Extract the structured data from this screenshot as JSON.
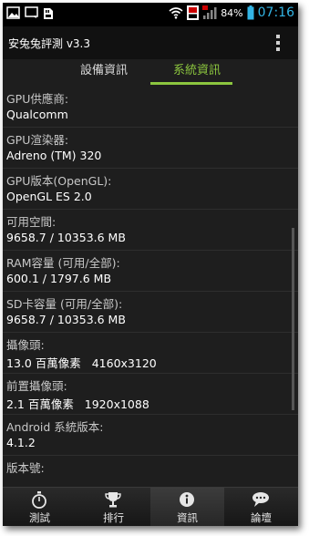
{
  "status_bar": {
    "battery_percent": "84%",
    "time": "07:16"
  },
  "app": {
    "title": "安兔兔評測 v3.3"
  },
  "tabs": [
    {
      "label": "設備資訊",
      "active": false
    },
    {
      "label": "系統資訊",
      "active": true
    }
  ],
  "items": [
    {
      "label": "GPU供應商:",
      "value": "Qualcomm"
    },
    {
      "label": "GPU渲染器:",
      "value": "Adreno (TM) 320"
    },
    {
      "label": "GPU版本(OpenGL):",
      "value": "OpenGL ES 2.0"
    },
    {
      "label": "可用空間:",
      "value": "9658.7 / 10353.6 MB"
    },
    {
      "label": "RAM容量 (可用/全部):",
      "value": "600.1 / 1797.6 MB"
    },
    {
      "label": "SD卡容量 (可用/全部):",
      "value": "9658.7 / 10353.6 MB"
    },
    {
      "label": "攝像頭:",
      "value": "13.0 百萬像素   4160x3120"
    },
    {
      "label": "前置攝像頭:",
      "value": "2.1 百萬像素   1920x1088"
    },
    {
      "label": "Android 系統版本:",
      "value": "4.1.2"
    },
    {
      "label": "版本號:",
      "value": ""
    }
  ],
  "bottom_nav": [
    {
      "label": "測試",
      "icon": "stopwatch-icon",
      "active": false
    },
    {
      "label": "排行",
      "icon": "trophy-icon",
      "active": false
    },
    {
      "label": "資訊",
      "icon": "info-icon",
      "active": true
    },
    {
      "label": "論壇",
      "icon": "chat-icon",
      "active": false
    }
  ],
  "colors": {
    "accent_green": "#8cc63f",
    "clock_blue": "#33b5e5",
    "background": "#1e1e1e"
  }
}
